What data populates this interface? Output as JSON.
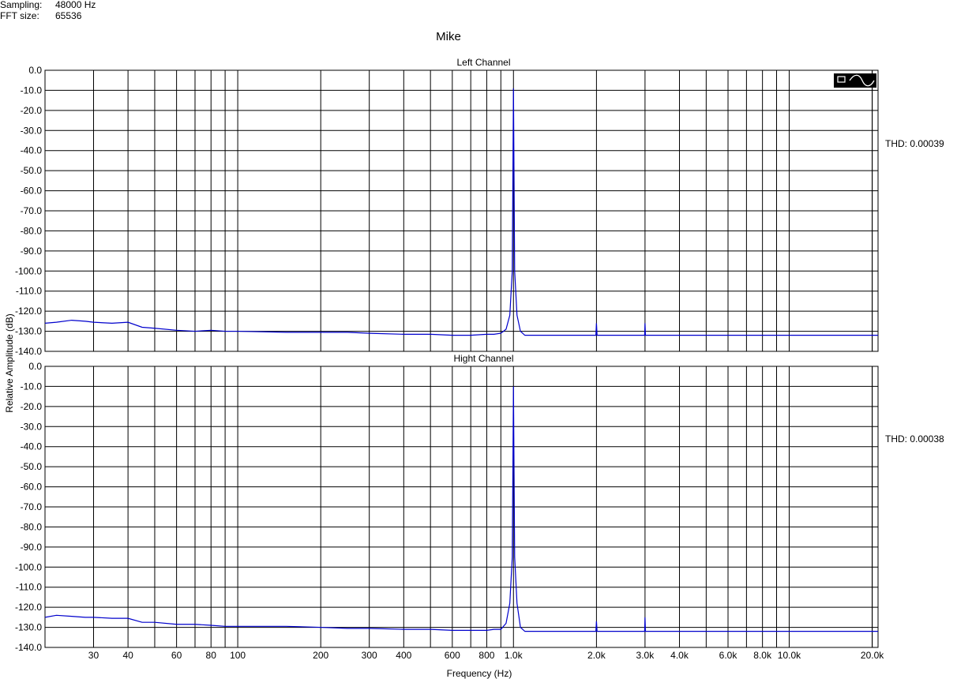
{
  "header": {
    "sampling_label": "Sampling:",
    "sampling_value": "48000 Hz",
    "fft_label": "FFT size:",
    "fft_value": "65536"
  },
  "title": "Mike",
  "y_axis_label": "Relative Amplitude (dB)",
  "x_axis_label": "Frequency (Hz)",
  "chart_data": [
    {
      "type": "line",
      "title": "Left Channel",
      "annotation": "THD: 0.00039",
      "xscale": "log",
      "xlim": [
        20,
        21000
      ],
      "ylim": [
        -140,
        0
      ],
      "grid": true,
      "legend_icon": "spectrum-sine-icon",
      "line_color": "#0000cc",
      "x_ticks": [
        30,
        40,
        60,
        80,
        100,
        200,
        300,
        400,
        600,
        800,
        1000,
        2000,
        3000,
        4000,
        6000,
        8000,
        10000,
        20000
      ],
      "x_tick_labels": [
        "30",
        "40",
        "60",
        "80",
        "100",
        "200",
        "300",
        "400",
        "600",
        "800",
        "1.0k",
        "2.0k",
        "3.0k",
        "4.0k",
        "6.0k",
        "8.0k",
        "10.0k",
        "20.0k"
      ],
      "y_ticks": [
        0,
        -10,
        -20,
        -30,
        -40,
        -50,
        -60,
        -70,
        -80,
        -90,
        -100,
        -110,
        -120,
        -130,
        -140
      ],
      "y_tick_labels": [
        "0.0",
        "-10.0",
        "-20.0",
        "-30.0",
        "-40.0",
        "-50.0",
        "-60.0",
        "-70.0",
        "-80.0",
        "-90.0",
        "-100.0",
        "-110.0",
        "-120.0",
        "-130.0",
        "-140.0"
      ],
      "series": [
        {
          "x": [
            20,
            22,
            25,
            28,
            30,
            35,
            40,
            45,
            50,
            60,
            70,
            80,
            90,
            100,
            150,
            200,
            250,
            300,
            400,
            500,
            600,
            700,
            800,
            850,
            900,
            940,
            970,
            990,
            1000,
            1010,
            1030,
            1060,
            1100,
            1200,
            1500,
            1990,
            2000,
            2010,
            2500,
            2990,
            3000,
            3010,
            4000,
            5000,
            6000,
            7000,
            8000,
            9000,
            10000,
            15000,
            20000,
            21000
          ],
          "y": [
            -126,
            -125.5,
            -124.5,
            -125,
            -125.5,
            -126,
            -125.5,
            -128,
            -128.5,
            -129.5,
            -130,
            -129.5,
            -130,
            -130,
            -130.5,
            -130.5,
            -130.5,
            -131,
            -131.5,
            -131.5,
            -132,
            -132,
            -131.5,
            -131.5,
            -131,
            -129,
            -122,
            -100,
            -9,
            -100,
            -122,
            -130,
            -132,
            -132,
            -132,
            -132,
            -126,
            -132,
            -132,
            -132,
            -126,
            -132,
            -132,
            -132,
            -132,
            -132,
            -132,
            -132,
            -132,
            -132,
            -132,
            -132
          ]
        }
      ]
    },
    {
      "type": "line",
      "title": "Hight Channel",
      "annotation": "THD: 0.00038",
      "xscale": "log",
      "xlim": [
        20,
        21000
      ],
      "ylim": [
        -140,
        0
      ],
      "grid": true,
      "line_color": "#0000cc",
      "x_ticks": [
        30,
        40,
        60,
        80,
        100,
        200,
        300,
        400,
        600,
        800,
        1000,
        2000,
        3000,
        4000,
        6000,
        8000,
        10000,
        20000
      ],
      "x_tick_labels": [
        "30",
        "40",
        "60",
        "80",
        "100",
        "200",
        "300",
        "400",
        "600",
        "800",
        "1.0k",
        "2.0k",
        "3.0k",
        "4.0k",
        "6.0k",
        "8.0k",
        "10.0k",
        "20.0k"
      ],
      "y_ticks": [
        0,
        -10,
        -20,
        -30,
        -40,
        -50,
        -60,
        -70,
        -80,
        -90,
        -100,
        -110,
        -120,
        -130,
        -140
      ],
      "y_tick_labels": [
        "0.0",
        "-10.0",
        "-20.0",
        "-30.0",
        "-40.0",
        "-50.0",
        "-60.0",
        "-70.0",
        "-80.0",
        "-90.0",
        "-100.0",
        "-110.0",
        "-120.0",
        "-130.0",
        "-140.0"
      ],
      "series": [
        {
          "x": [
            20,
            22,
            25,
            28,
            30,
            35,
            40,
            45,
            50,
            60,
            70,
            80,
            90,
            100,
            150,
            200,
            250,
            300,
            400,
            500,
            600,
            700,
            800,
            850,
            900,
            940,
            970,
            990,
            1000,
            1010,
            1030,
            1060,
            1100,
            1200,
            1500,
            1990,
            2000,
            2010,
            2500,
            2990,
            3000,
            3010,
            4000,
            5000,
            6000,
            7000,
            8000,
            9000,
            10000,
            15000,
            20000,
            21000
          ],
          "y": [
            -125,
            -124,
            -124.5,
            -125,
            -125,
            -125.5,
            -125.5,
            -127.5,
            -127.5,
            -128.5,
            -128.5,
            -129,
            -129.5,
            -129.5,
            -129.5,
            -130,
            -130.5,
            -130.5,
            -131,
            -131,
            -131.5,
            -131.5,
            -131.5,
            -131,
            -131,
            -128,
            -118,
            -95,
            -10,
            -95,
            -118,
            -130,
            -132,
            -132,
            -132,
            -132,
            -127,
            -132,
            -132,
            -132,
            -125,
            -132,
            -132,
            -132,
            -132,
            -132,
            -132,
            -132,
            -132,
            -132,
            -132,
            -132
          ]
        }
      ]
    }
  ]
}
